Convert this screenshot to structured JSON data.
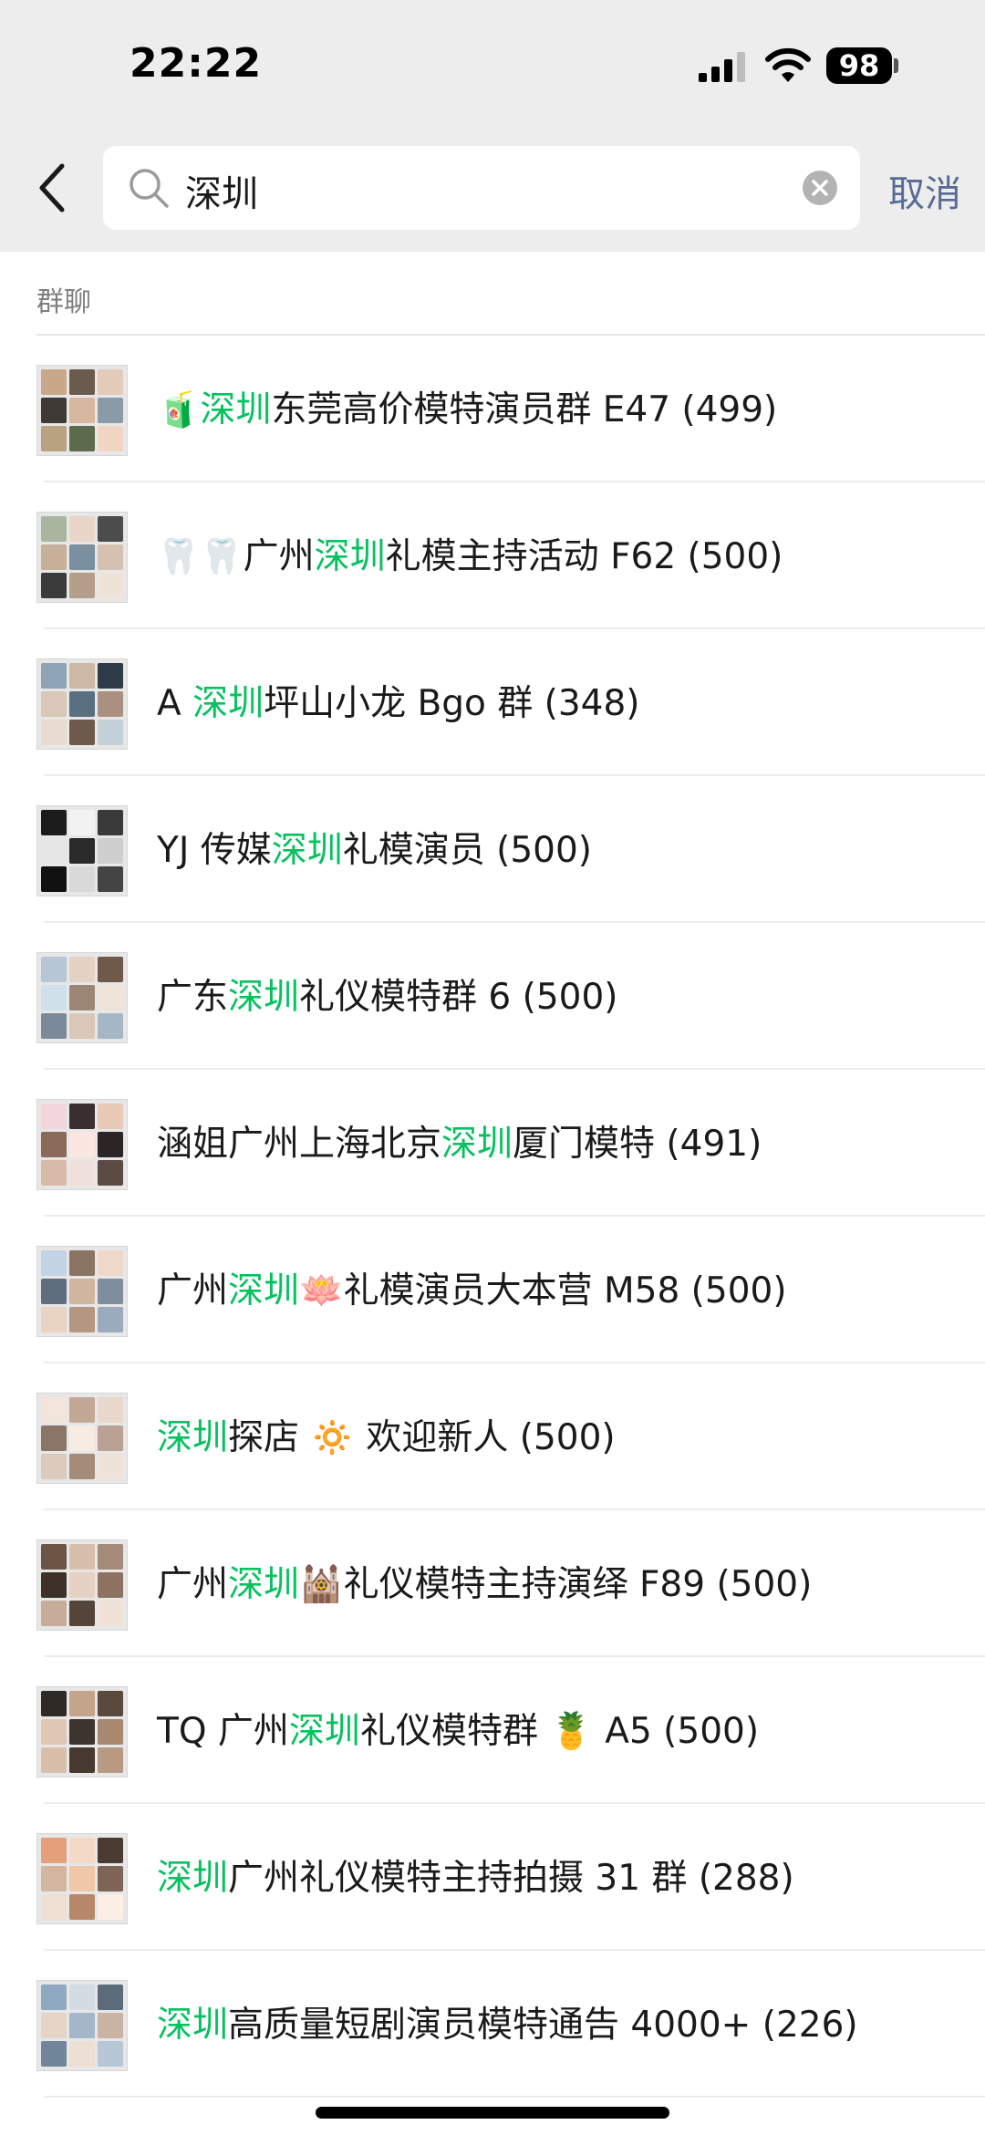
{
  "status": {
    "time": "22:22",
    "battery": "98"
  },
  "search": {
    "query": "深圳",
    "cancel_label": "取消"
  },
  "section": {
    "label": "群聊"
  },
  "results": [
    {
      "prefix": "🧃",
      "pre": "",
      "keyword": "深圳",
      "post": "东莞高价模特演员群 E47 (499)"
    },
    {
      "prefix": "🦷🦷",
      "pre": "广州",
      "keyword": "深圳",
      "post": "礼模主持活动 F62 (500)"
    },
    {
      "prefix": "",
      "pre": "A ",
      "keyword": "深圳",
      "post": "坪山小龙 Bgo 群 (348)"
    },
    {
      "prefix": "",
      "pre": "YJ 传媒",
      "keyword": "深圳",
      "post": "礼模演员 (500)"
    },
    {
      "prefix": "",
      "pre": "广东",
      "keyword": "深圳",
      "post": "礼仪模特群 6 (500)"
    },
    {
      "prefix": "",
      "pre": "涵姐广州上海北京",
      "keyword": "深圳",
      "post": "厦门模特 (491)"
    },
    {
      "prefix": "",
      "pre": "广州",
      "keyword": "深圳",
      "post": "🪷礼模演员大本营 M58 (500)"
    },
    {
      "prefix": "",
      "pre": "",
      "keyword": "深圳",
      "post": "探店 🔅 欢迎新人 (500)"
    },
    {
      "prefix": "",
      "pre": "广州",
      "keyword": "深圳",
      "post": "🕍礼仪模特主持演绎 F89 (500)"
    },
    {
      "prefix": "",
      "pre": "TQ 广州",
      "keyword": "深圳",
      "post": "礼仪模特群 🍍 A5 (500)"
    },
    {
      "prefix": "",
      "pre": "",
      "keyword": "深圳",
      "post": "广州礼仪模特主持拍摄 31 群 (288)"
    },
    {
      "prefix": "",
      "pre": "",
      "keyword": "深圳",
      "post": "高质量短剧演员模特通告 4000+ (226)"
    }
  ],
  "colors": {
    "highlight": "#07c160",
    "cancel": "#576b95",
    "header_bg": "#ededed"
  }
}
